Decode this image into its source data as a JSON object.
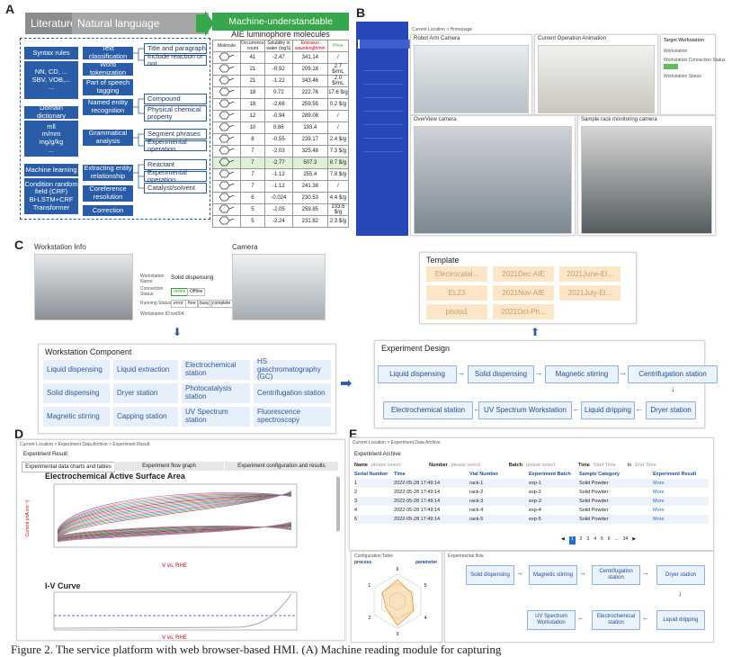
{
  "panels": {
    "a": "A",
    "b": "B",
    "c": "C",
    "d": "D",
    "e": "E"
  },
  "a": {
    "lit": "Literature",
    "nlp": "Natural language processing",
    "green": "Machine-understandable structured data",
    "tbl_title": "AIE luminophore molecules",
    "left_groups": [
      [
        "Syntax rules",
        "NN, CD, ...\nSBV, VOB,...",
        "..."
      ],
      [
        "Domain dictionary",
        "mll\nm/mm\nmg/g/kg",
        "..."
      ],
      [
        "Machine learning",
        "Condition random field (CRF)",
        "Bi-LSTM+CRF",
        "Transformer"
      ]
    ],
    "mid": [
      "Text classification",
      "Word tokenization",
      "Part of speech tagging",
      "Named entity recognition",
      "Grammatical analysis",
      "Extracting entity relationship",
      "Coreference resolution",
      "Correction"
    ],
    "right": [
      "Title and paragraph",
      "Include reaction or not",
      "Compound",
      "Physical chemical property",
      "Segment phrases",
      "Experimental operation",
      "Reactant",
      "Experimental operation",
      "Catalyst/solvent"
    ],
    "cols": [
      "Molecule",
      "Occurrence count",
      "Solubility in water (logS)",
      "Emission wavelength/nm",
      "Price"
    ],
    "rows": [
      [
        "41",
        "-2.47",
        "341.14",
        "/"
      ],
      [
        "21",
        "-0.92",
        "209.18",
        "2.7 $/mL"
      ],
      [
        "21",
        "-1.22",
        "343.46",
        "2.0 $/mL"
      ],
      [
        "18",
        "0.72",
        "222.76",
        "17.6 $/g"
      ],
      [
        "18",
        "-2.68",
        "259.55",
        "0.2 $/g"
      ],
      [
        "12",
        "-0.94",
        "289.08",
        "/"
      ],
      [
        "10",
        "0.86",
        "193.4",
        "/"
      ],
      [
        "8",
        "-0.55",
        "239.17",
        "2.4 $/g"
      ],
      [
        "7",
        "-2.03",
        "325.48",
        "7.3 $/g"
      ],
      [
        "7",
        "-2.77",
        "507.3",
        "8.7 $/g"
      ],
      [
        "7",
        "-1.12",
        "255.4",
        "7.8 $/g"
      ],
      [
        "7",
        "-1.12",
        "241.38",
        "/"
      ],
      [
        "6",
        "-0.024",
        "230.53",
        "4.4 $/g"
      ],
      [
        "5",
        "-2.05",
        "259.85",
        "133.6 $/g"
      ],
      [
        "5",
        "-2.24",
        "231.82",
        "2.3 $/g"
      ]
    ]
  },
  "b": {
    "location": "Current Location > Homepage",
    "cams": [
      "Robot Arm Camera",
      "Current Operation Animation",
      "OverView camera",
      "Sample rack monitoring camera"
    ],
    "side_title": "Target Workstation",
    "side_items": [
      "Workstation",
      "Workstation Connection Status",
      "Workstation Status"
    ]
  },
  "c": {
    "ws_title": "Workstation Info",
    "cam_title": "Camera",
    "ws_name_l": "Workstation Name:",
    "ws_name": "Solid dispensing",
    "conn_l": "Connection Status:",
    "online": "online",
    "offline": "Offline",
    "run_l": "Running Status:",
    "status_btns": [
      "error",
      "free",
      "busy",
      "complete"
    ],
    "id_l": "Workstation ID:",
    "id": "ws004",
    "comp_title": "Workstation Component",
    "comps": [
      "Liquid dispensing",
      "Liquid extraction",
      "Electrochemical station",
      "HS gaschromatography (GC)",
      "Solid dispensing",
      "Dryer station",
      "Photocatalysis station",
      "Centrifugation station",
      "Magnetic stirring",
      "Capping station",
      "UV Spectrum station",
      "Fluorescence spectroscopy"
    ],
    "tmpl_title": "Template",
    "tmpls": [
      "Electrocatal...",
      "2021Dec-AIE",
      "2021June-El...",
      "EL23",
      "2021Nov-AIE",
      "2021July-El...",
      "photo1",
      "2021Oct-Ph..."
    ],
    "design_title": "Experiment Design",
    "flow1": [
      "Liquid dispensing",
      "Solid dispensing",
      "Magnetic stirring",
      "Centrifugation station"
    ],
    "flow2": [
      "Electrochemical station",
      "UV Spectrum Workstation",
      "Liquid dripping",
      "Dryer station"
    ]
  },
  "d": {
    "location": "Current Location > Experiment Data Archive > Experiment Result",
    "result": "Experiment Result",
    "tabs": [
      "Experimental data charts and tables",
      "Experiment flow graph",
      "Experiment configuration and results"
    ],
    "chart1_title": "Electrochemical Active Surface Area",
    "chart2_title": "I-V Curve",
    "xlabel": "V vs. RHE",
    "ylabel": "Current (mA cm⁻²)"
  },
  "e": {
    "location": "Current Location > Experiment Data Archive",
    "archive": "Experiment Archive",
    "f_name": "Name",
    "f_name_ph": "please select",
    "f_number": "Number",
    "f_number_ph": "please select",
    "f_batch": "Batch",
    "f_batch_ph": "please select",
    "f_time": "Time",
    "f_start": "Start Time",
    "f_to": "to",
    "f_end": "End Time",
    "cols": [
      "Serial Number",
      "Time",
      "Vial Number",
      "Experiment Batch",
      "Sample Category",
      "Experiment Result"
    ],
    "rows": [
      [
        "1",
        "2022-05-28 17:49:14",
        "rack-1",
        "exp-1",
        "Solid Powder",
        "More"
      ],
      [
        "2",
        "2022-05-28 17:49:14",
        "rack-2",
        "exp-2",
        "Solid Powder",
        "More"
      ],
      [
        "3",
        "2022-05-28 17:49:14",
        "rack-3",
        "exp-3",
        "Solid Powder",
        "More"
      ],
      [
        "4",
        "2022-05-28 17:49:14",
        "rack-4",
        "exp-4",
        "Solid Powder",
        "More"
      ],
      [
        "5",
        "2022-05-28 17:49:14",
        "rack-5",
        "exp-5",
        "Solid Powder",
        "More"
      ]
    ],
    "pages": [
      "1",
      "2",
      "3",
      "4",
      "5",
      "6",
      "...",
      "34"
    ],
    "config_title": "Configuration Table",
    "process": "process",
    "parameter": "parameter",
    "radar_labels": [
      "6",
      "5",
      "4",
      "3",
      "2",
      "1"
    ],
    "flow_title": "Experimental flow",
    "flow1": [
      "Solid dispensing",
      "Magnetic stirring",
      "Centrifugation station",
      "Dryer station"
    ],
    "flow2": [
      "UV Spectrum Workstation",
      "Electrochemical station",
      "Liquid dripping"
    ]
  },
  "caption": "Figure 2. The service platform with web browser-based HMI. (A) Machine reading module for capturing"
}
